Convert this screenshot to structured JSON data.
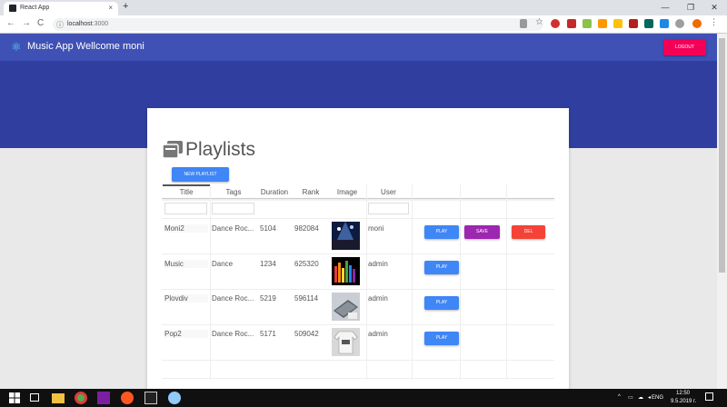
{
  "browser": {
    "tab_title": "React App",
    "tab_close": "×",
    "new_tab": "+",
    "url_host": "localhost",
    "url_port": ":3000",
    "nav": {
      "back": "←",
      "forward": "→",
      "reload": "C"
    },
    "window": {
      "minimize": "—",
      "restore": "❐",
      "close": "✕"
    }
  },
  "app": {
    "title": "Music App Wellcome moni",
    "logout_label": "LOGOUT"
  },
  "playlists": {
    "heading": "Playlists",
    "new_playlist_label": "NEW PLAYLIST",
    "columns": [
      "Title",
      "Tags",
      "Duration",
      "Rank",
      "Image",
      "User"
    ],
    "rows": [
      {
        "title": "Moni2",
        "tags": "Dance Roc...",
        "duration": "5104",
        "rank": "982084",
        "user": "moni",
        "image": "concert",
        "actions": [
          "PLAY",
          "SAVE",
          "DEL"
        ]
      },
      {
        "title": "Music",
        "tags": "Dance",
        "duration": "1234",
        "rank": "625320",
        "user": "admin",
        "image": "equalizer",
        "actions": [
          "PLAY"
        ]
      },
      {
        "title": "Plovdiv",
        "tags": "Dance Roc...",
        "duration": "5219",
        "rank": "596114",
        "user": "admin",
        "image": "laptop",
        "actions": [
          "PLAY"
        ]
      },
      {
        "title": "Pop2",
        "tags": "Dance Roc...",
        "duration": "5171",
        "rank": "509042",
        "user": "admin",
        "image": "shirt",
        "actions": [
          "PLAY"
        ]
      }
    ]
  },
  "taskbar": {
    "language": "ENG",
    "time": "12:50",
    "date": "9.5.2019 г."
  },
  "colors": {
    "appbar": "#3f51b5",
    "hero": "#303f9f",
    "play": "#3f86f6",
    "save": "#9c27b0",
    "del": "#f44336",
    "logout": "#f50057"
  }
}
